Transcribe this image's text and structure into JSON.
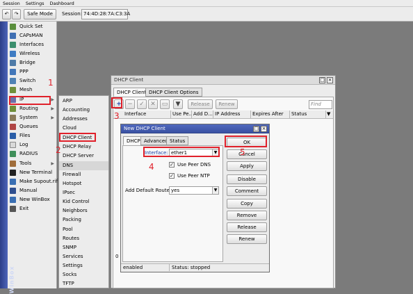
{
  "menubar": {
    "items": [
      "Session",
      "Settings",
      "Dashboard"
    ]
  },
  "toolbar": {
    "undo_icon": "undo-icon",
    "redo_icon": "redo-icon",
    "safe_mode": "Safe Mode",
    "session_label": "Session:",
    "session_value": "74:4D:28:7A:C3:3A"
  },
  "sidebar": {
    "brand": "WinBox",
    "items": [
      {
        "label": "Quick Set",
        "icon": "quick-set-icon",
        "color": "#5a8f3c"
      },
      {
        "label": "CAPsMAN",
        "icon": "capsman-icon",
        "color": "#3f6fb3"
      },
      {
        "label": "Interfaces",
        "icon": "interfaces-icon",
        "color": "#3c8f6e"
      },
      {
        "label": "Wireless",
        "icon": "wireless-icon",
        "color": "#3e7cc3"
      },
      {
        "label": "Bridge",
        "icon": "bridge-icon",
        "color": "#4e7ba8"
      },
      {
        "label": "PPP",
        "icon": "ppp-icon",
        "color": "#4277b9"
      },
      {
        "label": "Switch",
        "icon": "switch-icon",
        "color": "#4f82b4"
      },
      {
        "label": "Mesh",
        "icon": "mesh-icon",
        "color": "#6f8f3a"
      },
      {
        "label": "IP",
        "icon": "ip-icon",
        "color": "#6b6fa8"
      },
      {
        "label": "Routing",
        "icon": "routing-icon",
        "color": "#6f8f3a"
      },
      {
        "label": "System",
        "icon": "system-icon",
        "color": "#8a7a5a"
      },
      {
        "label": "Queues",
        "icon": "queues-icon",
        "color": "#b04545"
      },
      {
        "label": "Files",
        "icon": "files-icon",
        "color": "#2a5ea8"
      },
      {
        "label": "Log",
        "icon": "log-icon",
        "color": "#d9d9d9"
      },
      {
        "label": "RADIUS",
        "icon": "radius-icon",
        "color": "#3f8f5a"
      },
      {
        "label": "Tools",
        "icon": "tools-icon",
        "color": "#a06d3a"
      },
      {
        "label": "New Terminal",
        "icon": "terminal-icon",
        "color": "#222222"
      },
      {
        "label": "Make Supout.rif",
        "icon": "supout-icon",
        "color": "#3a6fb3"
      },
      {
        "label": "Manual",
        "icon": "manual-icon",
        "color": "#2f4f8f"
      },
      {
        "label": "New WinBox",
        "icon": "winbox-icon",
        "color": "#3a6fb3"
      },
      {
        "label": "Exit",
        "icon": "exit-icon",
        "color": "#555555"
      }
    ]
  },
  "submenu": {
    "items": [
      "ARP",
      "Accounting",
      "Addresses",
      "Cloud",
      "DHCP Client",
      "DHCP Relay",
      "DHCP Server",
      "DNS",
      "Firewall",
      "Hotspot",
      "IPsec",
      "Kid Control",
      "Neighbors",
      "Packing",
      "Pool",
      "Routes",
      "SNMP",
      "Services",
      "Settings",
      "Socks",
      "TFTP"
    ]
  },
  "dhcp_client_window": {
    "title": "DHCP Client",
    "tabs": [
      "DHCP Client",
      "DHCP Client Options"
    ],
    "buttons": {
      "add": "+",
      "release": "Release",
      "renew": "Renew"
    },
    "find_placeholder": "Find",
    "columns": [
      "Interface",
      "Use Pe...",
      "Add D...",
      "IP Address",
      "Expires After",
      "Status"
    ],
    "item_count": "0 ite"
  },
  "new_dhcp_client": {
    "title": "New DHCP Client",
    "tabs": [
      "DHCP",
      "Advanced",
      "Status"
    ],
    "interface_label": "Interface:",
    "interface_value": "ether1",
    "use_peer_dns": "Use Peer DNS",
    "use_peer_ntp": "Use Peer NTP",
    "add_default_route_label": "Add Default Route:",
    "add_default_route_value": "yes",
    "buttons": [
      "OK",
      "Cancel",
      "Apply",
      "Disable",
      "Comment",
      "Copy",
      "Remove",
      "Release",
      "Renew"
    ],
    "status_left": "enabled",
    "status_right": "Status: stopped"
  },
  "annotations": [
    "1",
    "2",
    "3",
    "4",
    "5"
  ],
  "colors": {
    "highlight": "#e0202a",
    "title_blue": "#3a51a3",
    "winbox_strip": "#2c3e88"
  }
}
